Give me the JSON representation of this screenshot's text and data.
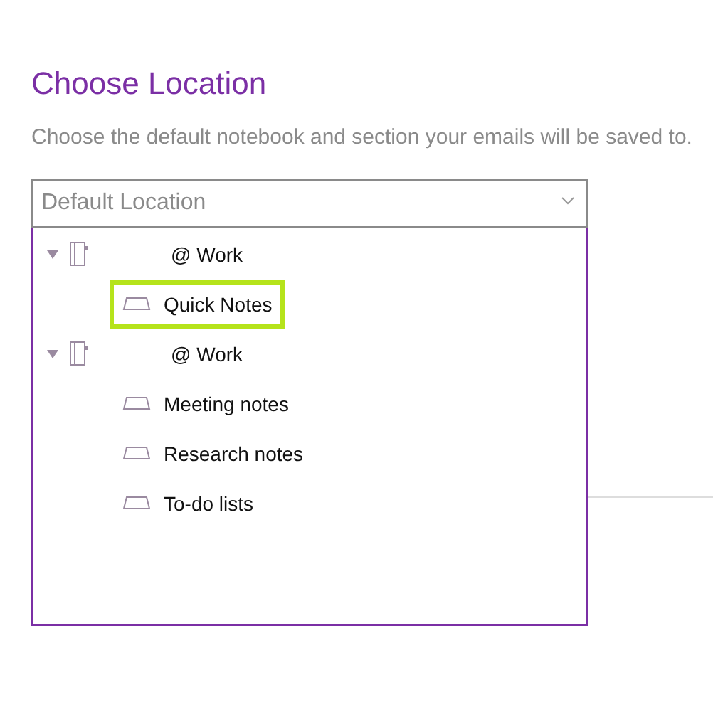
{
  "title": "Choose Location",
  "description": "Choose the default notebook and section your emails will be saved to.",
  "dropdown": {
    "placeholder": "Default Location",
    "expanded": true
  },
  "tree": [
    {
      "label": "@ Work",
      "expanded": true,
      "selected": false,
      "children": [
        {
          "label": "Quick Notes",
          "selected": true
        }
      ]
    },
    {
      "label": "@ Work",
      "expanded": true,
      "selected": false,
      "children": [
        {
          "label": "Meeting notes",
          "selected": false
        },
        {
          "label": "Research notes",
          "selected": false
        },
        {
          "label": "To-do lists",
          "selected": false
        }
      ]
    }
  ]
}
